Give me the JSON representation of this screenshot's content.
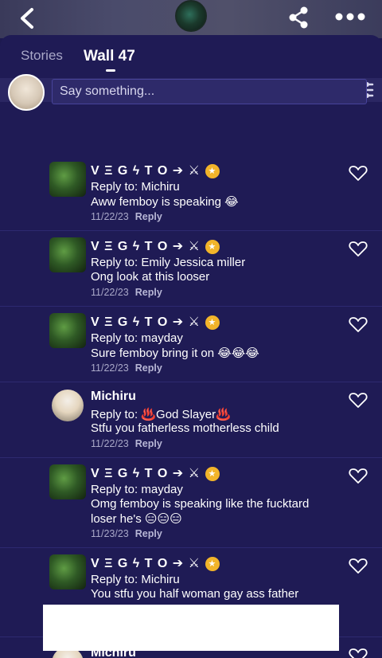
{
  "header": {
    "back_icon": "chevron-left-icon",
    "share_icon": "share-icon",
    "more_icon": "more-dots-icon"
  },
  "tabs": [
    {
      "label": "Stories"
    },
    {
      "label": "Wall 47"
    }
  ],
  "composer": {
    "placeholder": "Say something..."
  },
  "comments": [
    {
      "name": "V Ξ G ϟ T O ➔ ⚔",
      "reply_to": "Reply to: Michiru",
      "text": "Aww femboy is speaking 😂",
      "text2": "",
      "date": "11/22/23",
      "reply": "Reply",
      "badge": true
    },
    {
      "name": "V Ξ G ϟ T O ➔ ⚔",
      "reply_to": "Reply to: Emily Jessica miller",
      "text": "Ong look at this looser",
      "text2": "",
      "date": "11/22/23",
      "reply": "Reply",
      "badge": true
    },
    {
      "name": "V Ξ G ϟ T O ➔ ⚔",
      "reply_to": "Reply to: mayday",
      "text": "Sure femboy bring it on 😂😂😂",
      "text2": "",
      "date": "11/22/23",
      "reply": "Reply",
      "badge": true
    },
    {
      "name": "Michiru",
      "reply_to": "Reply to: ♨️God Slayer♨️",
      "text": "Stfu you fatherless motherless child",
      "text2": "",
      "date": "11/22/23",
      "reply": "Reply",
      "badge": false
    },
    {
      "name": "V Ξ G ϟ T O ➔ ⚔",
      "reply_to": "Reply to: mayday",
      "text": "Omg femboy is speaking like the fucktard",
      "text2": "loser he's 😑😑😑",
      "date": "11/23/23",
      "reply": "Reply",
      "badge": true
    },
    {
      "name": "V Ξ G ϟ T O ➔ ⚔",
      "reply_to": "Reply to: Michiru",
      "text": "You stfu you half woman gay ass father",
      "text2": "",
      "date": "",
      "reply": "",
      "badge": true
    },
    {
      "name": "Michiru",
      "reply_to": "",
      "text": "",
      "text2": "",
      "date": "",
      "reply": "",
      "badge": false
    }
  ],
  "colors": {
    "background": "#1d1a4f",
    "panel": "#1f1b55",
    "badge": "#f2b42a"
  }
}
